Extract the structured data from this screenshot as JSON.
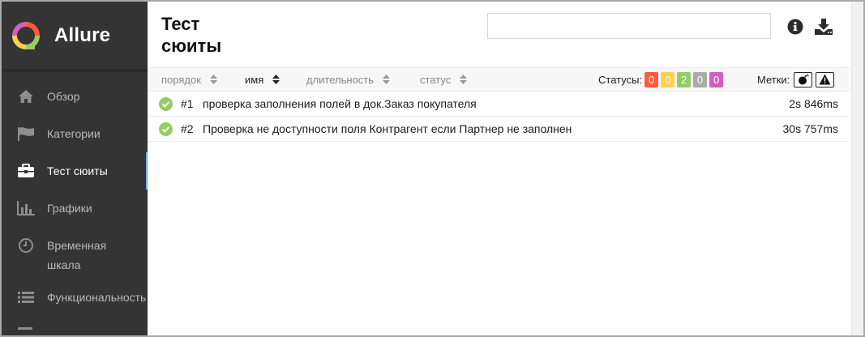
{
  "app": {
    "name": "Allure"
  },
  "sidebar": {
    "items": [
      {
        "label": "Обзор",
        "icon": "home-icon",
        "active": false
      },
      {
        "label": "Категории",
        "icon": "flag-icon",
        "active": false
      },
      {
        "label": "Тест сюиты",
        "icon": "briefcase-icon",
        "active": true
      },
      {
        "label": "Графики",
        "icon": "bar-chart-icon",
        "active": false
      },
      {
        "label": "Временная шкала",
        "icon": "clock-icon",
        "active": false
      },
      {
        "label": "Функциональность",
        "icon": "list-icon",
        "active": false
      }
    ]
  },
  "header": {
    "title": "Тест сюиты",
    "search_value": "",
    "info_icon": "info-icon",
    "download_icon": "download-icon"
  },
  "toolbar": {
    "sort_order": "порядок",
    "sort_name": "имя",
    "sort_duration": "длительность",
    "sort_status": "статус",
    "statuses_label": "Статусы:",
    "statuses": [
      {
        "name": "failed",
        "count": "0",
        "color": "#fd5a3e"
      },
      {
        "name": "broken",
        "count": "0",
        "color": "#ffd050"
      },
      {
        "name": "passed",
        "count": "2",
        "color": "#97cc64"
      },
      {
        "name": "skipped",
        "count": "0",
        "color": "#aaaaaa"
      },
      {
        "name": "unknown",
        "count": "0",
        "color": "#d35ebe"
      }
    ],
    "tags_label": "Метки:",
    "tags": [
      "bomb-icon",
      "warning-icon"
    ]
  },
  "rows": [
    {
      "num": "#1",
      "name": "проверка заполнения полей в док.Заказ покупателя",
      "duration": "2s 846ms",
      "status": "passed"
    },
    {
      "num": "#2",
      "name": "Проверка не доступности поля Контрагент если Партнер не заполнен",
      "duration": "30s 757ms",
      "status": "passed"
    }
  ],
  "colors": {
    "sidebar_bg": "#343434",
    "accent": "#64b4ff",
    "passed": "#97cc64"
  }
}
